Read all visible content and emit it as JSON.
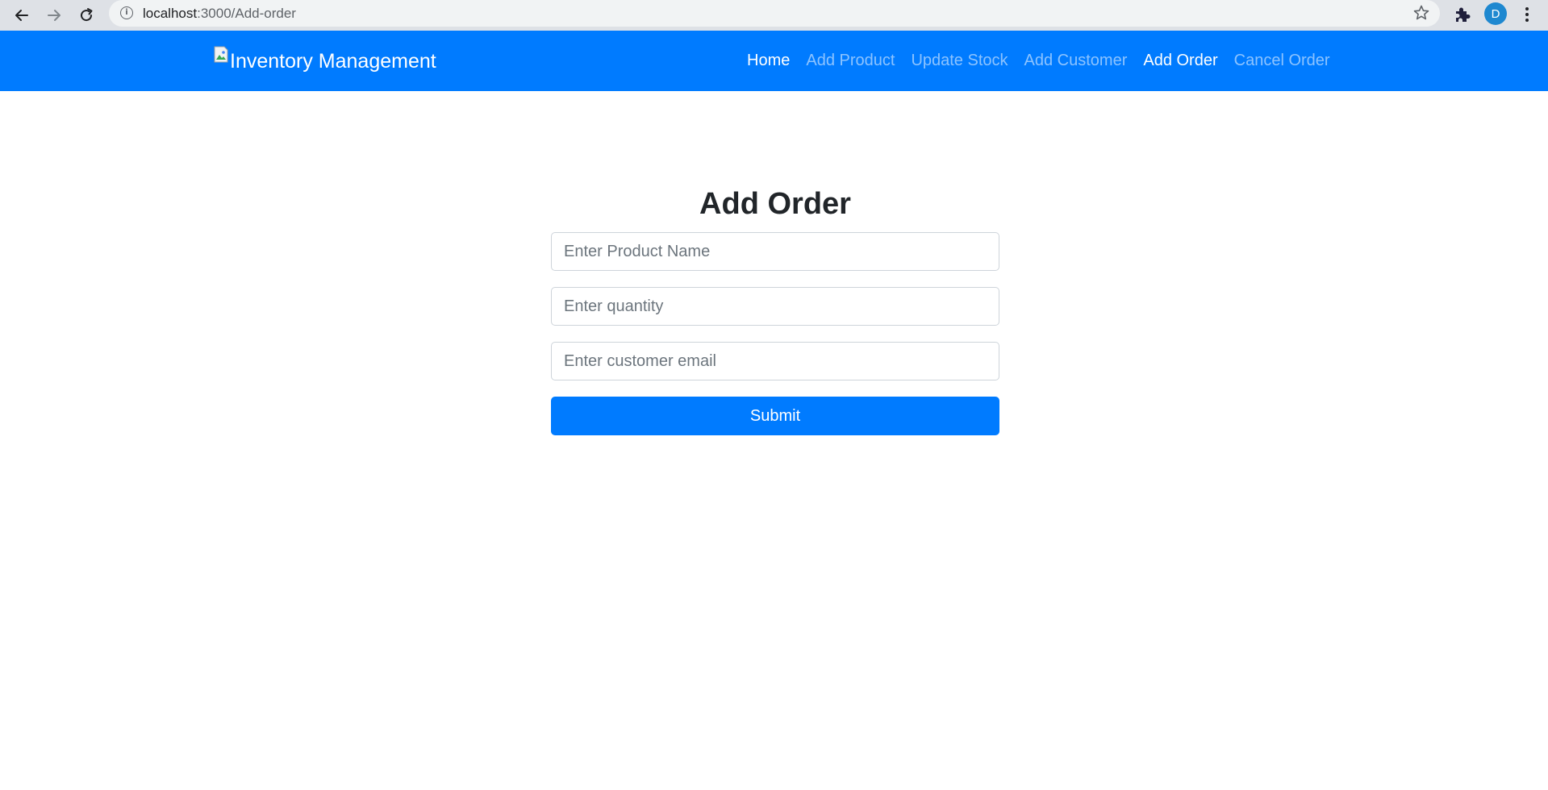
{
  "browser": {
    "url_host": "localhost",
    "url_path": ":3000/Add-order",
    "profile_initial": "D",
    "back_icon": "arrow-left-icon",
    "forward_icon": "arrow-right-icon",
    "reload_icon": "reload-icon",
    "star_icon": "star-icon",
    "extension_icon": "puzzle-icon",
    "menu_icon": "vertical-dots-icon",
    "colors": {
      "toolbar": "#dee1e6",
      "omnibox": "#f1f3f4",
      "avatar": "#1e88d0"
    }
  },
  "navbar": {
    "brand_label": "Inventory Management",
    "brand_icon": "broken-image-icon",
    "links": [
      {
        "label": "Home",
        "active": true
      },
      {
        "label": "Add Product",
        "active": false
      },
      {
        "label": "Update Stock",
        "active": false
      },
      {
        "label": "Add Customer",
        "active": false
      },
      {
        "label": "Add Order",
        "active": true
      },
      {
        "label": "Cancel Order",
        "active": false
      }
    ],
    "colors": {
      "background": "#007bff",
      "active_link": "#ffffff",
      "inactive_link": "rgba(255,255,255,0.55)"
    }
  },
  "form": {
    "title": "Add Order",
    "product_name": {
      "value": "",
      "placeholder": "Enter Product Name"
    },
    "quantity": {
      "value": "",
      "placeholder": "Enter quantity"
    },
    "customer_email": {
      "value": "",
      "placeholder": "Enter customer email"
    },
    "submit_label": "Submit",
    "colors": {
      "button": "#007bff",
      "input_border": "#ced4da"
    }
  }
}
